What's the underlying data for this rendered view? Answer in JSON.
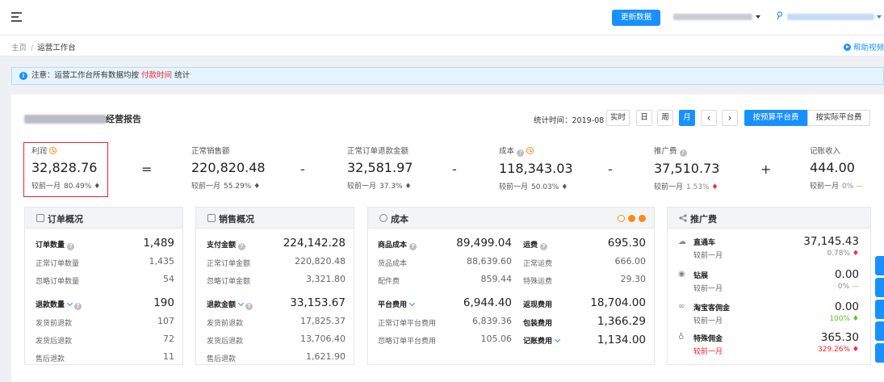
{
  "topbar": {
    "update_button": "更新数据"
  },
  "breadcrumb": {
    "home": "主页",
    "separator": "/",
    "current": "运营工作台",
    "help_video": "帮助视频"
  },
  "notice": {
    "prefix": "注意：运营工作台所有数据均按",
    "highlight": "付款时间",
    "suffix": "统计"
  },
  "report": {
    "title_suffix": "经营报告",
    "stat_time_label": "统计时间：",
    "stat_time_value": "2019-08",
    "period_buttons": [
      "实时",
      "日",
      "周",
      "月"
    ],
    "active_period": "月",
    "prev": "‹",
    "next": "›",
    "fee_buttons": [
      "按预算平台费",
      "按实际平台费"
    ],
    "active_fee": "按预算平台费"
  },
  "kpis": [
    {
      "label": "利润",
      "value": "32,828.76",
      "compare_label": "较前一月",
      "pct": "80.49%",
      "trend": "up"
    },
    {
      "label": "正常销售额",
      "value": "220,820.48",
      "compare_label": "较前一月",
      "pct": "55.29%",
      "trend": "up"
    },
    {
      "label": "正常订单退款金额",
      "value": "32,581.97",
      "compare_label": "较前一月",
      "pct": "37.3%",
      "trend": "up"
    },
    {
      "label": "成本",
      "value": "118,343.03",
      "compare_label": "较前一月",
      "pct": "50.03%",
      "trend": "up"
    },
    {
      "label": "推广费",
      "value": "37,510.73",
      "compare_label": "较前一月",
      "pct": "1.53%",
      "trend": "down"
    },
    {
      "label": "记账收入",
      "value": "444.00",
      "compare_label": "较前一月",
      "pct": "0%",
      "trend": "flat"
    }
  ],
  "operators": [
    "=",
    "-",
    "-",
    "-",
    "+"
  ],
  "orders_card": {
    "title": "订单概况",
    "rows": [
      {
        "label": "订单数量",
        "value": "1,489"
      },
      {
        "label": "正常订单数量",
        "value": "1,435"
      },
      {
        "label": "忽略订单数量",
        "value": "54"
      },
      {
        "label": "退款数量",
        "value": "190"
      },
      {
        "label": "发货前退款",
        "value": "107"
      },
      {
        "label": "发货后退款",
        "value": "72"
      },
      {
        "label": "售后退款",
        "value": "11"
      }
    ]
  },
  "sales_card": {
    "title": "销售概况",
    "rows": [
      {
        "label": "支付金额",
        "value": "224,142.28"
      },
      {
        "label": "正常订单金额",
        "value": "220,820.48"
      },
      {
        "label": "忽略订单金额",
        "value": "3,321.80"
      },
      {
        "label": "退款金额",
        "value": "33,153.67"
      },
      {
        "label": "发货前退款",
        "value": "17,825.37"
      },
      {
        "label": "发货后退款",
        "value": "13,706.40"
      },
      {
        "label": "售后退款",
        "value": "1,621.90"
      }
    ]
  },
  "cost_card": {
    "title": "成本",
    "left": [
      {
        "label": "商品成本",
        "value": "89,499.04"
      },
      {
        "label": "货品成本",
        "value": "88,639.60"
      },
      {
        "label": "配件费",
        "value": "859.44"
      },
      {
        "label": "平台费用",
        "value": "6,944.40"
      },
      {
        "label": "正常订单平台费用",
        "value": "6,839.36"
      },
      {
        "label": "忽略订单平台费用",
        "value": "105.06"
      }
    ],
    "right": [
      {
        "label": "运费",
        "value": "695.30"
      },
      {
        "label": "正常运费",
        "value": "666.00"
      },
      {
        "label": "特殊运费",
        "value": "29.30"
      },
      {
        "label": "返现费用",
        "value": "18,704.00"
      },
      {
        "label": "包装费用",
        "value": "1,366.29"
      },
      {
        "label": "记账费用",
        "value": "1,134.00"
      }
    ]
  },
  "promo_card": {
    "title": "推广费",
    "items": [
      {
        "label": "直通车",
        "value": "37,145.43",
        "compare_label": "较前一月",
        "pct": "0.78%",
        "trend": "down"
      },
      {
        "label": "钻展",
        "value": "0.00",
        "compare_label": "较前一月",
        "pct": "0%",
        "trend": "flat"
      },
      {
        "label": "淘宝客佣金",
        "value": "0.00",
        "compare_label": "较前一月",
        "pct": "100%",
        "trend": "up"
      },
      {
        "label": "特殊佣金",
        "value": "365.30",
        "compare_label": "较前一月",
        "pct": "329.26%",
        "trend": "down"
      }
    ]
  },
  "colors": {
    "accent": "#1890ff",
    "up": "#52c41a",
    "down": "#f5222d",
    "warning": "#fa8c16"
  }
}
